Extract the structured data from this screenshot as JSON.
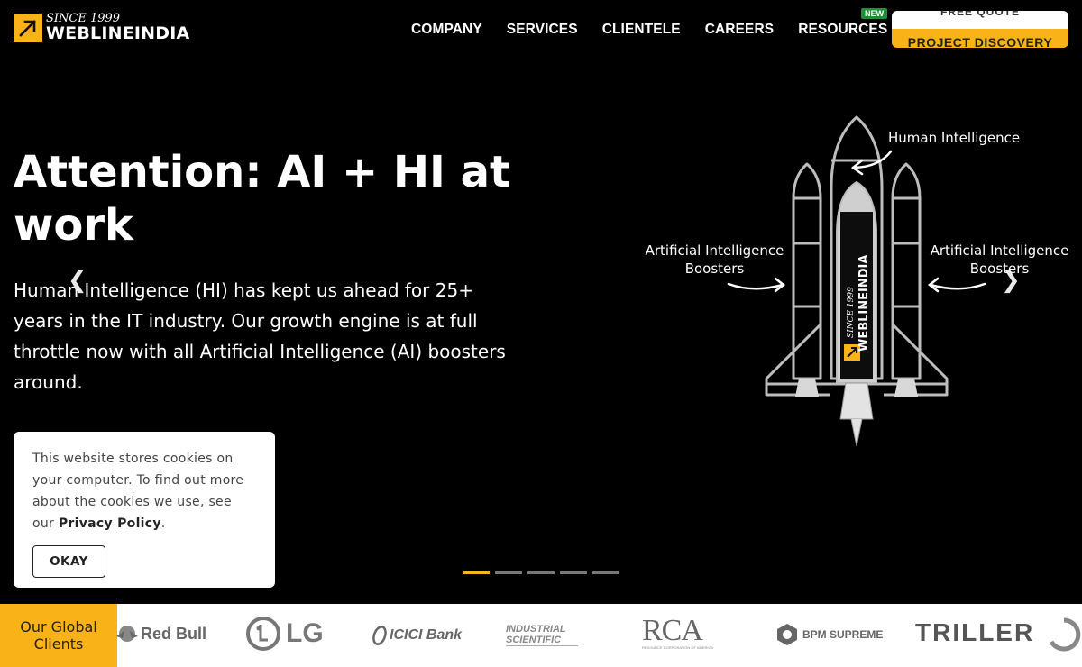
{
  "brand": {
    "since": "SINCE 1999",
    "name": "WEBLINEINDIA",
    "accent": "#f9b318"
  },
  "nav": {
    "items": [
      {
        "label": "COMPANY"
      },
      {
        "label": "SERVICES"
      },
      {
        "label": "CLIENTELE"
      },
      {
        "label": "CAREERS"
      },
      {
        "label": "RESOURCES",
        "badge": "NEW"
      }
    ]
  },
  "cta": {
    "quote_label": "FREE QUOTE",
    "discovery_label": "PROJECT DISCOVERY"
  },
  "hero": {
    "title": "Attention: AI + HI at work",
    "text": "Human Intelligence (HI) has kept us ahead for 25+ years in the IT industry. Our growth engine is at full throttle now with all Artificial Intelligence (AI) boosters around.",
    "label_hi": "Human Intelligence",
    "label_ai_left": "Artificial Intelligence Boosters",
    "label_ai_right": "Artificial Intelligence Boosters",
    "shuttle_brand_since": "SINCE 1999",
    "shuttle_brand_name": "WEBLINEINDIA",
    "prev_icon": "chevron-left",
    "next_icon": "chevron-right"
  },
  "slider": {
    "count": 5,
    "active_index": 0
  },
  "cookie": {
    "text_before": "This website stores cookies on your computer. To find out more about the cookies we use, see our ",
    "link": "Privacy Policy",
    "text_after": ".",
    "button": "OKAY"
  },
  "clients": {
    "label": "Our Global Clients",
    "logos": [
      "Red Bull",
      "LG",
      "ICICI Bank",
      "INDUSTRIAL SCIENTIFIC",
      "RCA",
      "BPM SUPREME",
      "TRILLER"
    ],
    "rca_sub": "RESOURCE CORPORATION OF AMERICA"
  }
}
